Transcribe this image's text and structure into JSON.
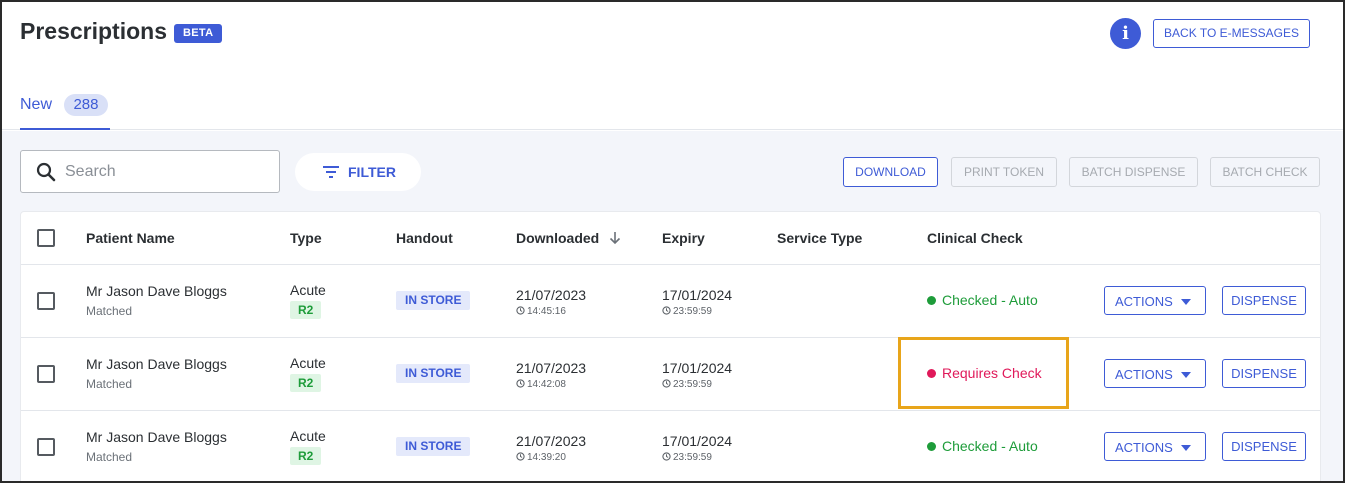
{
  "header": {
    "title": "Prescriptions",
    "beta_badge": "BETA",
    "info_icon": "info-icon",
    "back_button": "BACK TO E-MESSAGES"
  },
  "tabs": [
    {
      "label": "New",
      "count": "288"
    }
  ],
  "toolbar": {
    "search_placeholder": "Search",
    "filter_label": "FILTER",
    "download": "DOWNLOAD",
    "print_token": "PRINT TOKEN",
    "batch_dispense": "BATCH DISPENSE",
    "batch_check": "BATCH CHECK"
  },
  "table": {
    "columns": [
      "Patient Name",
      "Type",
      "Handout",
      "Downloaded",
      "Expiry",
      "Service Type",
      "Clinical Check"
    ],
    "rows": [
      {
        "patient_name": "Mr Jason Dave Bloggs",
        "patient_status": "Matched",
        "type": "Acute",
        "type_badge": "R2",
        "handout": "IN STORE",
        "downloaded_date": "21/07/2023",
        "downloaded_time": "14:45:16",
        "expiry_date": "17/01/2024",
        "expiry_time": "23:59:59",
        "service_type": "",
        "clinical_check": "Checked - Auto",
        "clinical_check_status": "ok",
        "actions_label": "ACTIONS",
        "dispense_label": "DISPENSE"
      },
      {
        "patient_name": "Mr Jason Dave Bloggs",
        "patient_status": "Matched",
        "type": "Acute",
        "type_badge": "R2",
        "handout": "IN STORE",
        "downloaded_date": "21/07/2023",
        "downloaded_time": "14:42:08",
        "expiry_date": "17/01/2024",
        "expiry_time": "23:59:59",
        "service_type": "",
        "clinical_check": "Requires Check",
        "clinical_check_status": "required",
        "actions_label": "ACTIONS",
        "dispense_label": "DISPENSE"
      },
      {
        "patient_name": "Mr Jason Dave Bloggs",
        "patient_status": "Matched",
        "type": "Acute",
        "type_badge": "R2",
        "handout": "IN STORE",
        "downloaded_date": "21/07/2023",
        "downloaded_time": "14:39:20",
        "expiry_date": "17/01/2024",
        "expiry_time": "23:59:59",
        "service_type": "",
        "clinical_check": "Checked - Auto",
        "clinical_check_status": "ok",
        "actions_label": "ACTIONS",
        "dispense_label": "DISPENSE"
      }
    ]
  },
  "colors": {
    "accent": "#3e5bd6",
    "checked_ok": "#1e9c3a",
    "requires_check": "#e0195a",
    "highlight": "#e8a51a"
  }
}
